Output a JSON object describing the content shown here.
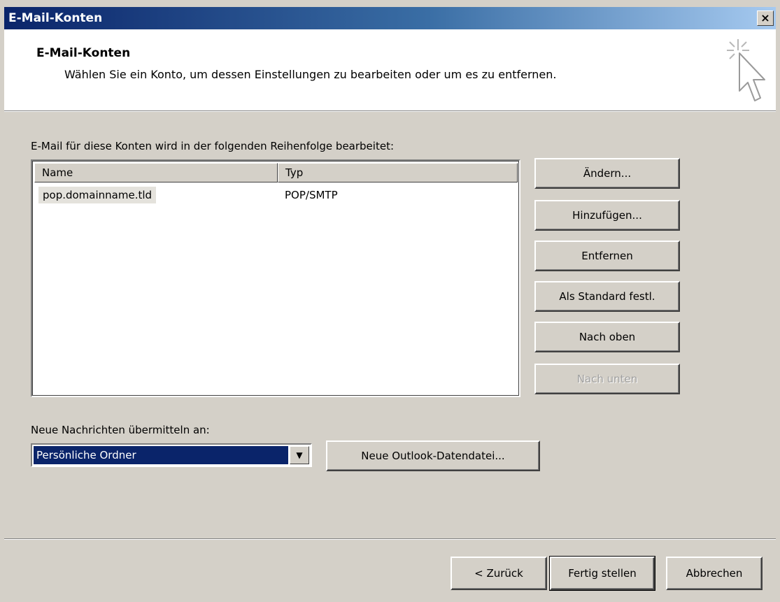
{
  "window": {
    "title": "E-Mail-Konten",
    "close_glyph": "×"
  },
  "header": {
    "title": "E-Mail-Konten",
    "subtitle": "Wählen Sie ein Konto, um dessen Einstellungen zu bearbeiten oder um es zu entfernen.",
    "icon": "wizard-cursor-icon"
  },
  "accounts": {
    "label": "E-Mail für diese Konten wird in der folgenden Reihenfolge bearbeitet:",
    "columns": [
      "Name",
      "Typ"
    ],
    "rows": [
      {
        "name": "pop.domainname.tld",
        "type": "POP/SMTP"
      }
    ]
  },
  "side_buttons": {
    "change": "Ändern...",
    "add": "Hinzufügen...",
    "remove": "Entfernen",
    "set_default": "Als Standard festl.",
    "move_up": "Nach oben",
    "move_down": "Nach unten"
  },
  "delivery": {
    "label": "Neue Nachrichten übermitteln an:",
    "selected": "Persönliche Ordner",
    "new_file_button": "Neue Outlook-Datendatei..."
  },
  "footer": {
    "back": "< Zurück",
    "finish": "Fertig stellen",
    "cancel": "Abbrechen"
  },
  "colors": {
    "title_bar": "#0a246a",
    "dialog_bg": "#d4d0c8",
    "selection": "#0a246a"
  }
}
